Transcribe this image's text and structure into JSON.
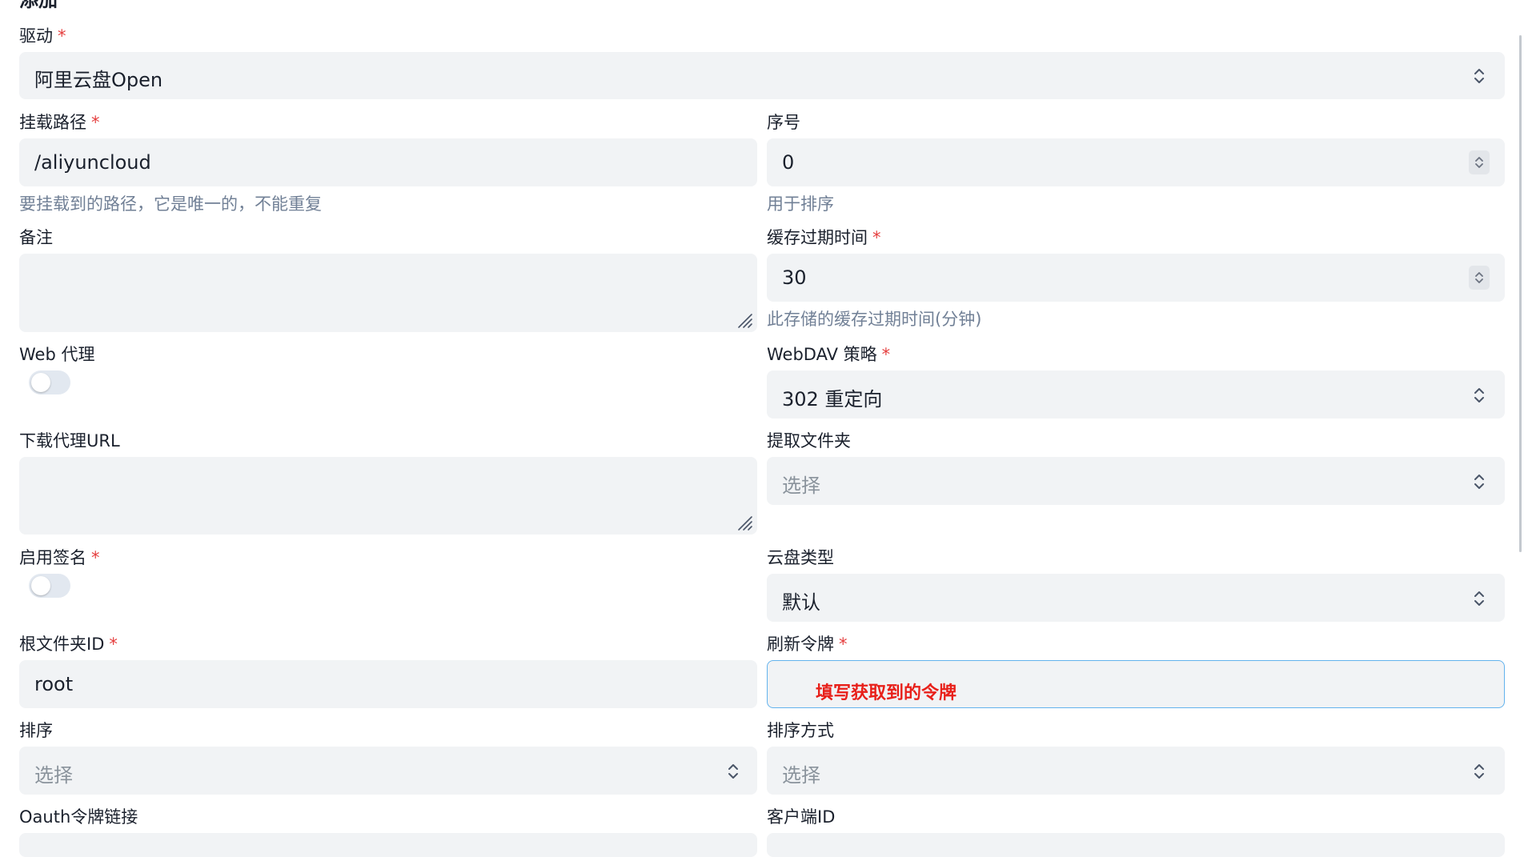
{
  "page": {
    "title": "添加"
  },
  "fields": {
    "driver": {
      "label": "驱动",
      "required": "*",
      "value": "阿里云盘Open"
    },
    "mount_path": {
      "label": "挂载路径",
      "required": "*",
      "value": "/aliyuncloud",
      "hint": "要挂载到的路径，它是唯一的，不能重复"
    },
    "order": {
      "label": "序号",
      "value": "0",
      "hint": "用于排序"
    },
    "remark": {
      "label": "备注",
      "value": ""
    },
    "cache_expiration": {
      "label": "缓存过期时间",
      "required": "*",
      "value": "30",
      "hint": "此存储的缓存过期时间(分钟)"
    },
    "web_proxy": {
      "label": "Web 代理",
      "enabled": false
    },
    "webdav_policy": {
      "label": "WebDAV 策略",
      "required": "*",
      "value": "302 重定向"
    },
    "download_proxy_url": {
      "label": "下载代理URL",
      "value": ""
    },
    "extract_folder": {
      "label": "提取文件夹",
      "placeholder": "选择"
    },
    "enable_sign": {
      "label": "启用签名",
      "required": "*",
      "enabled": false
    },
    "drive_type": {
      "label": "云盘类型",
      "value": "默认"
    },
    "root_folder_id": {
      "label": "根文件夹ID",
      "required": "*",
      "value": "root"
    },
    "refresh_token": {
      "label": "刷新令牌",
      "required": "*",
      "value": "",
      "annotation": "填写获取到的令牌"
    },
    "order_by": {
      "label": "排序",
      "placeholder": "选择"
    },
    "order_direction": {
      "label": "排序方式",
      "placeholder": "选择"
    },
    "oauth_token_url": {
      "label": "Oauth令牌链接"
    },
    "client_id": {
      "label": "客户端ID"
    }
  },
  "colors": {
    "required_mark": "#e53e3e",
    "focus_border": "#63b3ed",
    "annotation_text": "#e8201a",
    "input_bg": "#f1f3f5"
  }
}
